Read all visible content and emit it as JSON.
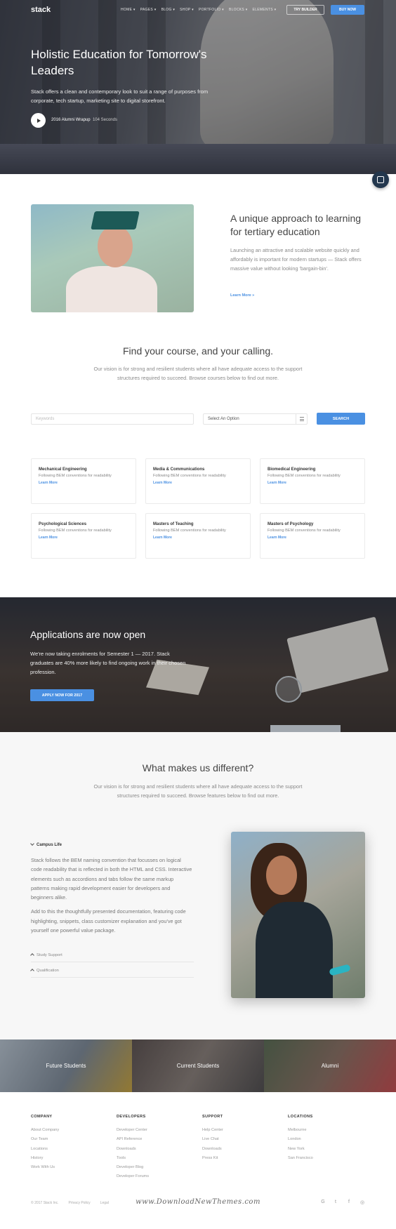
{
  "brand": {
    "logo": "stack",
    "accent": "#4a90e2"
  },
  "nav": {
    "items": [
      "HOME ▾",
      "PAGES ▾",
      "BLOG ▾",
      "SHOP ▾",
      "PORTFOLIO ▾",
      "BLOCKS ▾",
      "ELEMENTS ▾"
    ],
    "try_builder": "TRY BUILDER",
    "buy_now": "BUY NOW"
  },
  "hero": {
    "title": "Holistic Education for Tomorrow's Leaders",
    "subtitle": "Stack offers a clean and contemporary look to suit a range of purposes from corporate, tech startup, marketing site to digital storefront.",
    "video_label": "2016 Alumni Wrapup",
    "video_duration": "104 Seconds"
  },
  "intro": {
    "title": "A unique approach to learning for tertiary education",
    "text": "Launching an attractive and scalable website quickly and affordably is important for modern startups — Stack offers massive value without looking 'bargain-bin'.",
    "link": "Learn More »"
  },
  "courses": {
    "title": "Find your course, and your calling.",
    "text": "Our vision is for strong and resilient students where all have adequate access to the support structures required to succeed. Browse courses below to find out more.",
    "keywords_placeholder": "Keywords",
    "select_value": "Select An Option",
    "search_label": "SEARCH",
    "cards": [
      {
        "title": "Mechanical Engineering",
        "desc": "Following BEM conventions for readability",
        "link": "Learn More"
      },
      {
        "title": "Media & Communications",
        "desc": "Following BEM conventions for readability",
        "link": "Learn More"
      },
      {
        "title": "Biomedical Engineering",
        "desc": "Following BEM conventions for readability",
        "link": "Learn More"
      },
      {
        "title": "Psychological Sciences",
        "desc": "Following BEM conventions for readability",
        "link": "Learn More"
      },
      {
        "title": "Masters of Teaching",
        "desc": "Following BEM conventions for readability",
        "link": "Learn More"
      },
      {
        "title": "Masters of Psychology",
        "desc": "Following BEM conventions for readability",
        "link": "Learn More"
      }
    ]
  },
  "applications": {
    "title": "Applications are now open",
    "text": "We're now taking enrolments for Semester 1 — 2017. Stack graduates are 40% more likely to find ongoing work in their chosen profession.",
    "button": "APPLY NOW FOR 2017"
  },
  "different": {
    "title": "What makes us different?",
    "text": "Our vision is for strong and resilient students where all have adequate access to the support structures required to succeed. Browse features below to find out more.",
    "accordion": {
      "open_title": "Campus Life",
      "open_p1": "Stack follows the BEM naming convention that focusses on logical code readability that is reflected in both the HTML and CSS. Interactive elements such as accordions and tabs follow the same markup patterns making rapid development easier for developers and beginners alike.",
      "open_p2": "Add to this the thoughtfully presented documentation, featuring code highlighting, snippets, class customizer explanation and you've got yourself one powerful value package.",
      "closed": [
        "Study Support",
        "Qualification"
      ]
    }
  },
  "tiles": [
    "Future Students",
    "Current Students",
    "Alumni"
  ],
  "footer": {
    "columns": [
      {
        "heading": "COMPANY",
        "links": [
          "About Company",
          "Our Team",
          "Locations",
          "History",
          "Work With Us"
        ]
      },
      {
        "heading": "DEVELOPERS",
        "links": [
          "Developer Center",
          "API Reference",
          "Downloads",
          "Tools",
          "Developer Blog",
          "Developer Forums"
        ]
      },
      {
        "heading": "SUPPORT",
        "links": [
          "Help Center",
          "Live Chat",
          "Downloads",
          "Press Kit"
        ]
      },
      {
        "heading": "LOCATIONS",
        "links": [
          "Melbourne",
          "London",
          "New York",
          "San Francisco"
        ]
      }
    ],
    "copyright": "© 2017 Stack Inc.",
    "privacy": "Privacy Policy",
    "legal": "Legal",
    "watermark": "www.DownloadNewThemes.com",
    "social": [
      "G",
      "t",
      "f",
      "◎"
    ]
  }
}
